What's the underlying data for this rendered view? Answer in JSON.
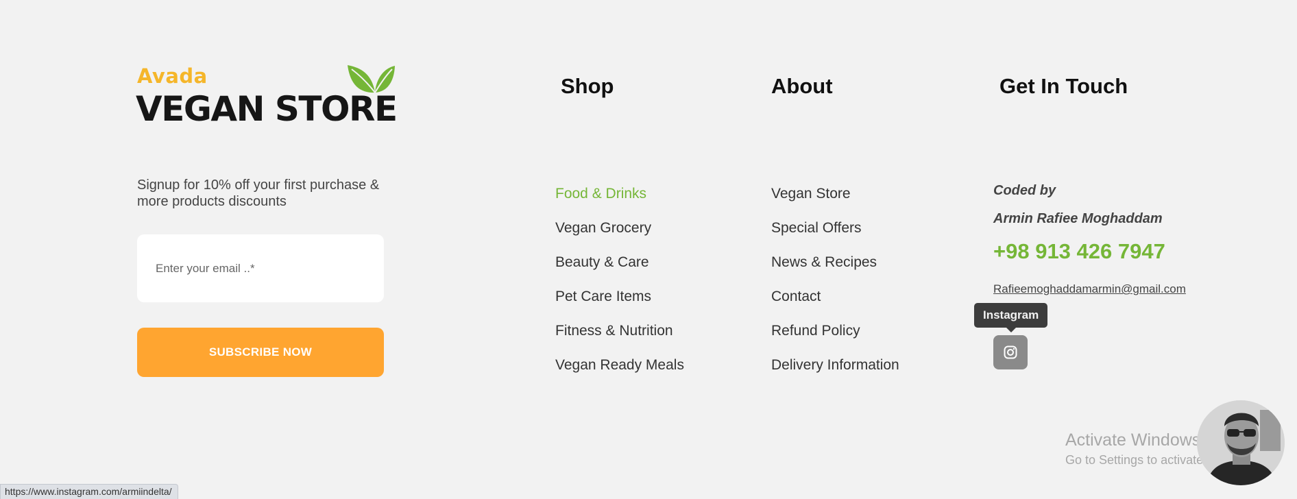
{
  "logo": {
    "small_text": "Avada",
    "big_text": "VEGAN STORE"
  },
  "signup": {
    "text": "Signup for 10% off your first purchase & more products discounts",
    "email_placeholder": "Enter your email ..*",
    "email_value": "",
    "button_label": "SUBSCRIBE NOW"
  },
  "shop": {
    "heading": "Shop",
    "items": [
      {
        "label": "Food & Drinks"
      },
      {
        "label": "Vegan Grocery"
      },
      {
        "label": "Beauty & Care"
      },
      {
        "label": "Pet Care Items"
      },
      {
        "label": "Fitness & Nutrition"
      },
      {
        "label": "Vegan Ready Meals"
      }
    ]
  },
  "about": {
    "heading": "About",
    "items": [
      {
        "label": "Vegan Store"
      },
      {
        "label": "Special Offers"
      },
      {
        "label": "News & Recipes"
      },
      {
        "label": "Contact"
      },
      {
        "label": "Refund Policy"
      },
      {
        "label": "Delivery Information"
      }
    ]
  },
  "contact": {
    "heading": "Get In Touch",
    "coded_by": "Coded by",
    "author": "Armin Rafiee Moghaddam",
    "phone": "+98 913 426 7947",
    "email": "Rafieemoghaddamarmin@gmail.com",
    "instagram_tooltip": "Instagram",
    "instagram_icon": "instagram-icon"
  },
  "windows_watermark": {
    "line1": "Activate Windows",
    "line2": "Go to Settings to activate Windows."
  },
  "status_bar": {
    "url": "https://www.instagram.com/armiindelta/"
  },
  "colors": {
    "background": "#f2f2f2",
    "accent_green": "#75b637",
    "accent_orange": "#ffa530",
    "logo_yellow": "#f5b62a"
  }
}
